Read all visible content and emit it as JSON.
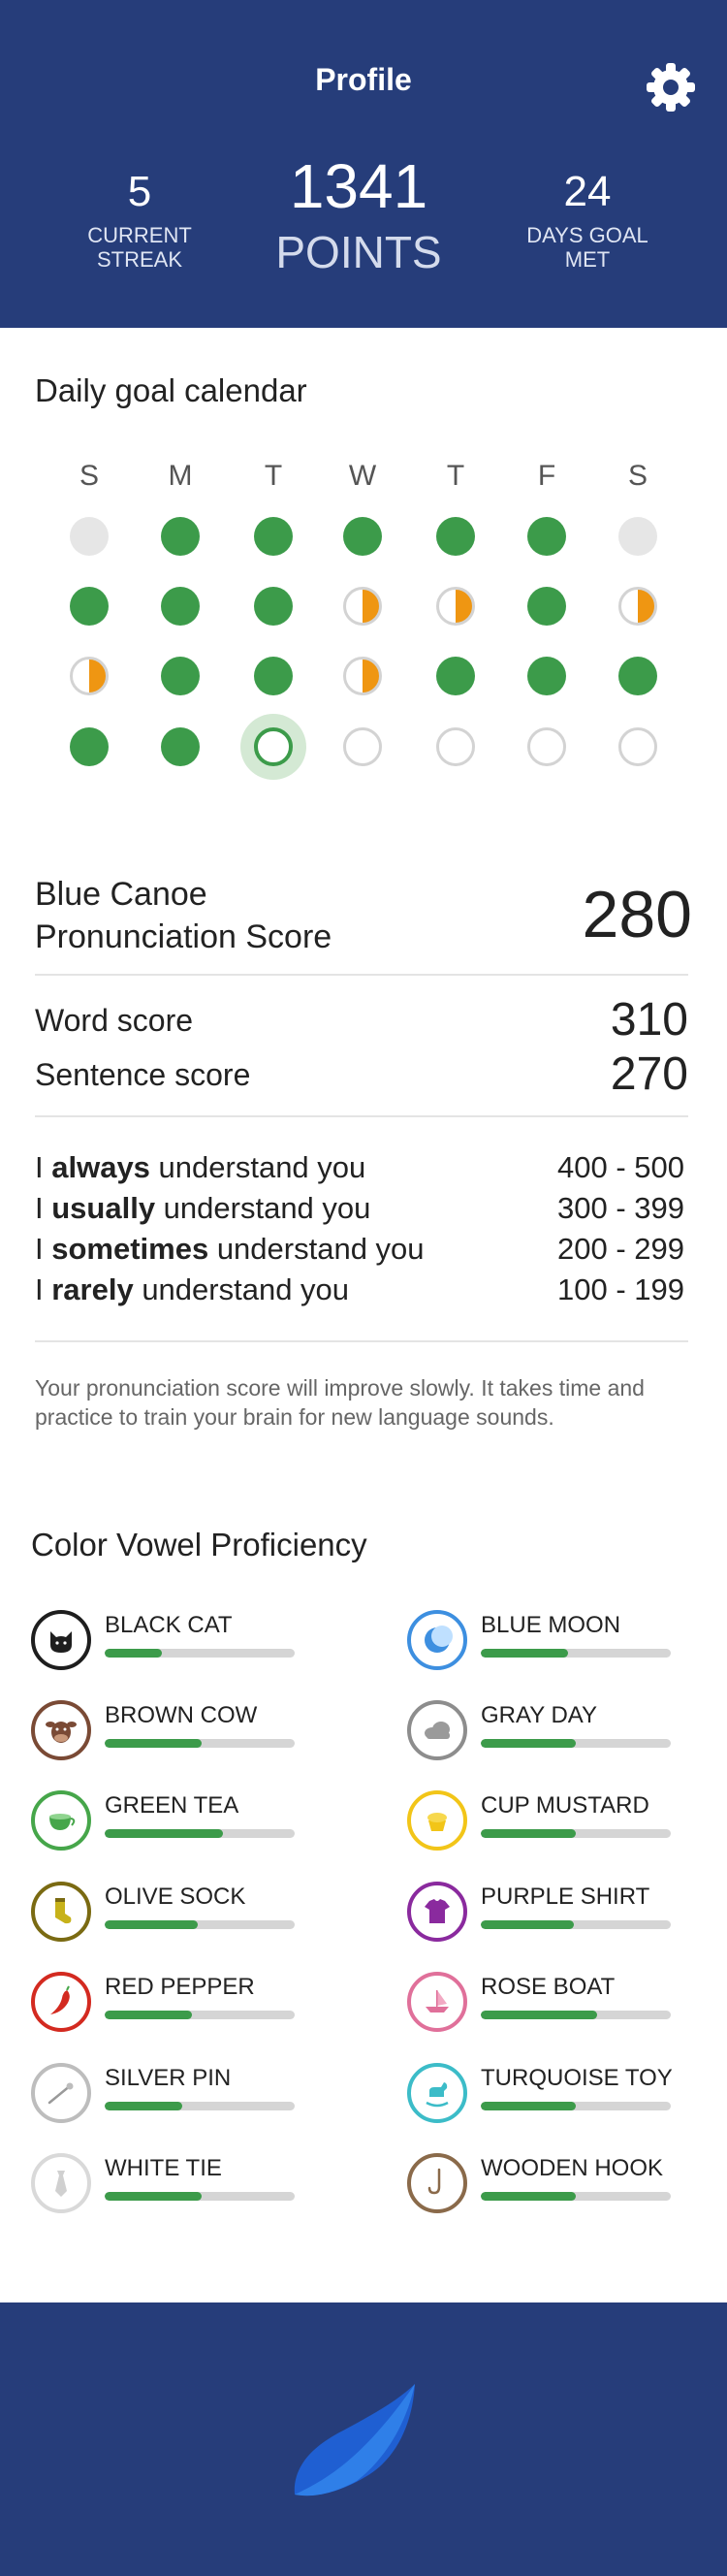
{
  "header": {
    "title": "Profile",
    "streak": {
      "value": "5",
      "label": "CURRENT STREAK"
    },
    "points": {
      "value": "1341",
      "label": "POINTS"
    },
    "days": {
      "value": "24",
      "label": "DAYS GOAL MET"
    },
    "settings_icon": "gear-icon"
  },
  "calendar": {
    "title": "Daily goal calendar",
    "days_of_week": [
      "S",
      "M",
      "T",
      "W",
      "T",
      "F",
      "S"
    ],
    "weeks": [
      [
        "off",
        "full",
        "full",
        "full",
        "full",
        "full",
        "off"
      ],
      [
        "full",
        "full",
        "full",
        "half",
        "half",
        "full",
        "half"
      ],
      [
        "half",
        "full",
        "full",
        "half",
        "full",
        "full",
        "full"
      ],
      [
        "full",
        "full",
        "today",
        "empty",
        "empty",
        "empty",
        "empty"
      ]
    ],
    "colors": {
      "complete": "#3c9b4a",
      "partial": "#ef9612",
      "empty": "#d3d3d3"
    }
  },
  "pronunciation": {
    "title_line1": "Blue Canoe",
    "title_line2": "Pronunciation Score",
    "score": "280",
    "word_label": "Word score",
    "word_score": "310",
    "sentence_label": "Sentence score",
    "sentence_score": "270",
    "levels": [
      {
        "pre": "I ",
        "strong": "always",
        "post": " understand you",
        "range": "400 - 500"
      },
      {
        "pre": "I ",
        "strong": "usually",
        "post": " understand you",
        "range": "300 - 399"
      },
      {
        "pre": "I ",
        "strong": "sometimes",
        "post": " understand you",
        "range": "200 - 299"
      },
      {
        "pre": "I ",
        "strong": "rarely",
        "post": " understand you",
        "range": "100 - 199"
      }
    ],
    "note": "Your pronunciation score will improve slowly. It takes time and practice to train your brain for new language sounds."
  },
  "vowels": {
    "title": "Color Vowel Proficiency",
    "items": [
      {
        "name": "BLACK CAT",
        "icon": "cat-icon",
        "color": "#1e1e1e",
        "progress": 0.3
      },
      {
        "name": "BLUE MOON",
        "icon": "moon-icon",
        "color": "#3d8fe0",
        "progress": 0.46
      },
      {
        "name": "BROWN COW",
        "icon": "cow-icon",
        "color": "#7a4a35",
        "progress": 0.51
      },
      {
        "name": "GRAY DAY",
        "icon": "cloud-icon",
        "color": "#8d8d8d",
        "progress": 0.5
      },
      {
        "name": "GREEN TEA",
        "icon": "tea-cup-icon",
        "color": "#46a64a",
        "progress": 0.62
      },
      {
        "name": "CUP MUSTARD",
        "icon": "mustard-cup-icon",
        "color": "#f2c518",
        "progress": 0.5
      },
      {
        "name": "OLIVE SOCK",
        "icon": "sock-icon",
        "color": "#7a6a12",
        "progress": 0.49
      },
      {
        "name": "PURPLE SHIRT",
        "icon": "shirt-icon",
        "color": "#8a2a9e",
        "progress": 0.49
      },
      {
        "name": "RED PEPPER",
        "icon": "pepper-icon",
        "color": "#d32a20",
        "progress": 0.46
      },
      {
        "name": "ROSE BOAT",
        "icon": "boat-icon",
        "color": "#e0709a",
        "progress": 0.61
      },
      {
        "name": "SILVER PIN",
        "icon": "pin-icon",
        "color": "#bdbdbd",
        "progress": 0.41
      },
      {
        "name": "TURQUOISE TOY",
        "icon": "rocking-horse-icon",
        "color": "#3cbcc8",
        "progress": 0.5
      },
      {
        "name": "WHITE TIE",
        "icon": "tie-icon",
        "color": "#d9d9d9",
        "progress": 0.51
      },
      {
        "name": "WOODEN HOOK",
        "icon": "hook-icon",
        "color": "#8a6a4a",
        "progress": 0.5
      }
    ]
  },
  "footer": {
    "logo_icon": "canoe-logo-icon"
  }
}
